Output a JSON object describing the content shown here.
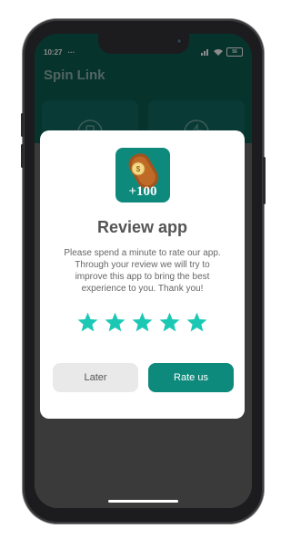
{
  "status_bar": {
    "time": "10:27",
    "dots": "···",
    "battery": "56"
  },
  "app": {
    "title": "Spin Link"
  },
  "dialog": {
    "icon_badge": "+100",
    "title": "Review app",
    "message": "Please spend a minute to rate our app. Through your review we will try to improve this app to bring the best experience to you. Thank you!",
    "rating": 5,
    "max_rating": 5,
    "later_label": "Later",
    "rate_label": "Rate us"
  },
  "colors": {
    "primary": "#0e8a7c",
    "star": "#1bc8b4",
    "app_bar": "#0d5d53"
  }
}
